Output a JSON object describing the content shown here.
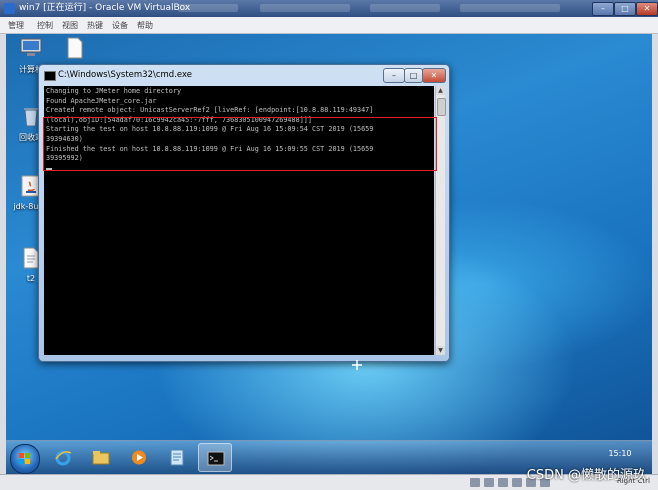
{
  "vbox": {
    "title": "win7 [正在运行] - Oracle VM VirtualBox",
    "menu": [
      "管理",
      "控制",
      "视图",
      "热键",
      "设备",
      "帮助"
    ],
    "controls": {
      "minimize": "–",
      "maximize": "□",
      "close": "✕"
    },
    "status_right": "Right Ctrl"
  },
  "desktop": {
    "icons": [
      {
        "label": "计算机"
      },
      {
        "label": ""
      },
      {
        "label": "回收站"
      },
      {
        "label": "jdk-8u20"
      },
      {
        "label": "t2"
      }
    ]
  },
  "cmd": {
    "title": "C:\\Windows\\System32\\cmd.exe",
    "buttons": {
      "minimize": "–",
      "maximize": "□",
      "close": "✕"
    },
    "lines": [
      "Changing to JMeter home directory",
      "Found ApacheJMeter_core.jar",
      "Created remote object: UnicastServerRef2 [liveRef: [endpoint:[10.8.88.119:49347]",
      "(local),objID:[54adaf70:16c9942ca45:-7fff, 7368305100947269488]]]",
      "Starting the test on host 10.8.88.119:1099 @ Fri Aug 16 15:09:54 CST 2019 (15659",
      "39394630)",
      "Finished the test on host 10.8.88.119:1099 @ Fri Aug 16 15:09:55 CST 2019 (15659",
      "39395992)"
    ]
  },
  "taskbar": {
    "items": [
      "internet-explorer",
      "windows-explorer",
      "media-player",
      "notepad",
      "command-prompt"
    ],
    "clock": "15:10"
  },
  "watermark": "CSDN @懒散的源玖"
}
